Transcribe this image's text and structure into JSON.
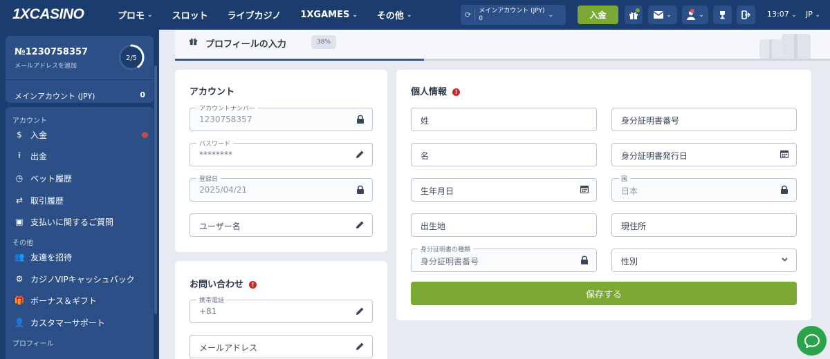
{
  "header": {
    "logo": "1XCASINO",
    "nav": [
      {
        "label": "プロモ",
        "has_dropdown": true
      },
      {
        "label": "スロット",
        "has_dropdown": false
      },
      {
        "label": "ライブカジノ",
        "has_dropdown": false
      },
      {
        "label": "1XGAMES",
        "has_dropdown": true
      },
      {
        "label": "その他",
        "has_dropdown": true
      }
    ],
    "account_label": "メインアカウント (JPY)",
    "account_balance": "0",
    "deposit_label": "入金",
    "time": "13:07",
    "language": "JP",
    "icons": [
      "refresh-icon",
      "gift-icon",
      "mail-icon",
      "user-icon",
      "trophy-icon",
      "logout-icon"
    ]
  },
  "sidebar": {
    "account_number": "№1230758357",
    "add_email": "メールアドレスを追加",
    "progress": "2/5",
    "progress_fraction": 0.4,
    "main_account_label": "メインアカウント (JPY)",
    "main_account_value": "0",
    "sections": {
      "account": "アカウント",
      "other": "その他",
      "profile": "プロフィール"
    },
    "account_items": [
      {
        "label": "入金",
        "icon": "dollar-icon",
        "alert": true
      },
      {
        "label": "出金",
        "icon": "upload-icon",
        "alert": false
      },
      {
        "label": "ベット履歴",
        "icon": "clock-icon",
        "alert": false
      },
      {
        "label": "取引履歴",
        "icon": "transfer-icon",
        "alert": false
      },
      {
        "label": "支払いに関するご質問",
        "icon": "faq-icon",
        "alert": false
      }
    ],
    "other_items": [
      {
        "label": "友達を招待",
        "icon": "friends-icon"
      },
      {
        "label": "カジノVIPキャッシュバック",
        "icon": "vip-icon"
      },
      {
        "label": "ボーナス＆ギフト",
        "icon": "gift-icon"
      },
      {
        "label": "カスタマーサポート",
        "icon": "support-icon"
      }
    ]
  },
  "progress_header": {
    "title": "プロフィールの入力",
    "percent": "38%",
    "percent_value": 0.38
  },
  "account_card": {
    "title": "アカウント",
    "fields": [
      {
        "label": "アカウントナンバー",
        "value": "1230758357",
        "icon": "lock-icon"
      },
      {
        "label": "パスワード",
        "value": "********",
        "icon": "pencil-icon"
      },
      {
        "label": "登録日",
        "value": "2025/04/21",
        "icon": "lock-icon"
      },
      {
        "label": "",
        "placeholder": "ユーザー名",
        "icon": "pencil-icon"
      }
    ]
  },
  "contact_card": {
    "title": "お問い合わせ",
    "fields": [
      {
        "label": "携帯電話",
        "value": "+81",
        "icon": "pencil-icon"
      },
      {
        "label": "",
        "placeholder": "メールアドレス",
        "icon": "pencil-icon"
      }
    ]
  },
  "personal_card": {
    "title": "個人情報",
    "left_fields": [
      {
        "placeholder": "姓",
        "icon": ""
      },
      {
        "placeholder": "名",
        "icon": ""
      },
      {
        "placeholder": "生年月日",
        "icon": "calendar-icon"
      },
      {
        "placeholder": "出生地",
        "icon": ""
      },
      {
        "label": "身分証明書の種類",
        "value": "身分証明書番号",
        "icon": "lock-icon"
      }
    ],
    "right_fields": [
      {
        "placeholder": "身分証明書番号",
        "icon": ""
      },
      {
        "placeholder": "身分証明書発行日",
        "icon": "calendar-icon"
      },
      {
        "label": "国",
        "value": "日本",
        "icon": "lock-icon"
      },
      {
        "placeholder": "現住所",
        "icon": ""
      },
      {
        "placeholder": "性別",
        "icon": "chevron-down-icon"
      }
    ],
    "save_label": "保存する"
  },
  "colors": {
    "header_bg": "#1a3c6e",
    "panel_bg": "#2b4f86",
    "accent_green": "#7ba934",
    "page_bg": "#e7ebf1",
    "alert_red": "#c42b2b"
  }
}
